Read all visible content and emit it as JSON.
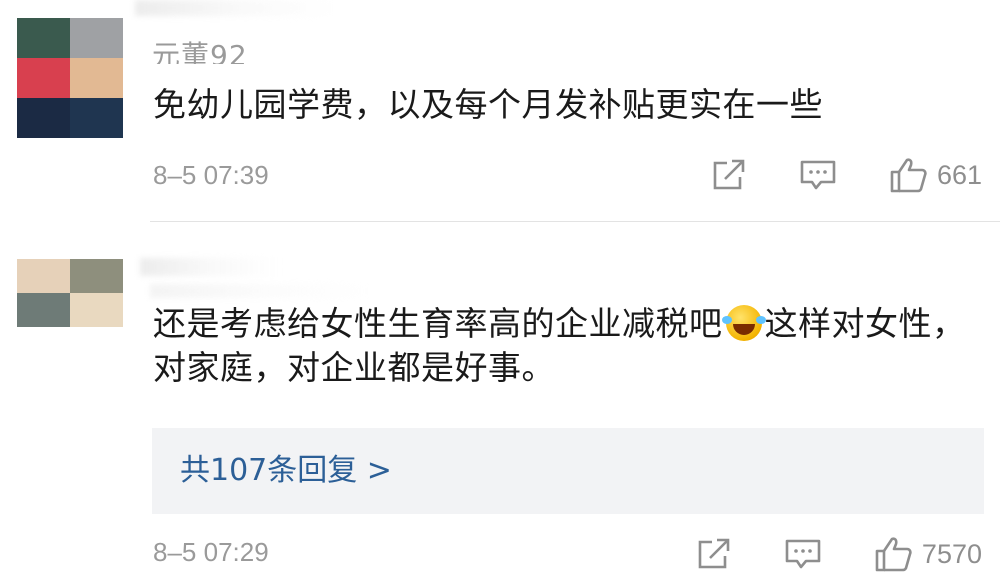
{
  "comments": [
    {
      "username": "元董92",
      "text": "免幼儿园学费，以及每个月发补贴更实在一些",
      "time": "8–5 07:39",
      "like_count": "661",
      "avatar_colors": [
        "#3a5a4e",
        "#9fa1a4",
        "#d8404f",
        "#e2b993",
        "#1b2a44",
        "#1f3550"
      ]
    },
    {
      "username": "",
      "text_part1": "还是考虑给女性生育率高的企业减税吧",
      "emoji": "laugh-cry-emoji",
      "text_part2": "这样对女性，对家庭，对企业都是好事。",
      "replies_label": "共107条回复 >",
      "time": "8–5 07:29",
      "like_count": "7570",
      "avatar_colors": [
        "#e6d1b9",
        "#8e8f7d",
        "#6e7b77",
        "#e9d9c0",
        "#ffffff",
        "#ffffff"
      ]
    }
  ],
  "colors": {
    "link": "#2c5f97",
    "meta": "#9a9a9a",
    "divider": "#e3e3e3",
    "reply_box": "#f2f3f5"
  },
  "icons": [
    "share-icon",
    "comment-icon",
    "thumbs-up-icon"
  ]
}
